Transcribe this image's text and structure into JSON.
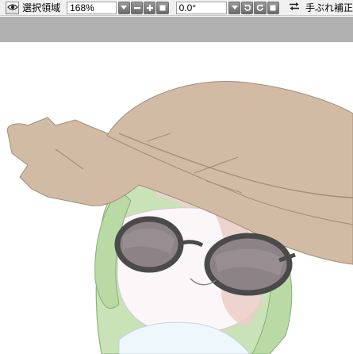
{
  "toolbar": {
    "selection_label": "選択領域",
    "zoom_value": "168%",
    "angle_value": "0.0°",
    "stabilizer_label": "手ぶれ補正"
  },
  "icons": {
    "visibility": "eye-icon",
    "zoom_dropdown": "dropdown-arrow-icon",
    "zoom_out": "minus-icon",
    "zoom_in": "plus-icon",
    "zoom_reset": "square-icon",
    "angle_dropdown": "dropdown-arrow-icon",
    "rotate_left": "rotate-left-icon",
    "rotate_right": "rotate-right-icon",
    "angle_reset": "square-icon",
    "flip": "flip-horizontal-icon"
  },
  "colors": {
    "toolbar_bg": "#f0f0f0",
    "canvas_band": "#b1b1b1",
    "canvas_bg": "#ffffff",
    "hat": "#d0b9a2",
    "hair": "#b8d6a6",
    "glasses_frame": "#4a4a4a",
    "lens": "#8a7f82",
    "blush": "#e8c7c2"
  }
}
